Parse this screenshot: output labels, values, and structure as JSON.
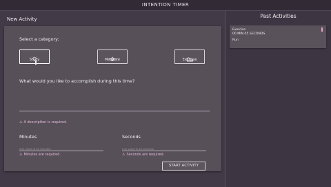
{
  "app": {
    "title": "INTENTION TIMER"
  },
  "new_activity": {
    "heading": "New Activity",
    "category_prompt": "Select a category:",
    "categories": [
      {
        "label": "Study",
        "icon": "lightbulb-icon",
        "selected": true
      },
      {
        "label": "Meditate",
        "icon": "lotus-icon",
        "selected": false
      },
      {
        "label": "Exercise",
        "icon": "sneaker-icon",
        "selected": false
      }
    ],
    "description_prompt": "What would you like to accomplish during this time?",
    "description_error": "A description is required.",
    "minutes": {
      "label": "Minutes",
      "placeholder": "min value is 00 minutes",
      "error": "Minutes are required."
    },
    "seconds": {
      "label": "Seconds",
      "placeholder": "min value is 00 seconds",
      "error": "Seconds are required."
    },
    "start_button": "START ACTIVITY"
  },
  "past_activities": {
    "heading": "Past Activities",
    "items": [
      {
        "category": "Exercise",
        "duration": "00 MIN 05 SECONDS",
        "description": "Run"
      }
    ]
  },
  "colors": {
    "background": "#3c3340",
    "card": "#575059",
    "error_text": "#e7b9d8",
    "past_marker": "#e9a0c2"
  }
}
